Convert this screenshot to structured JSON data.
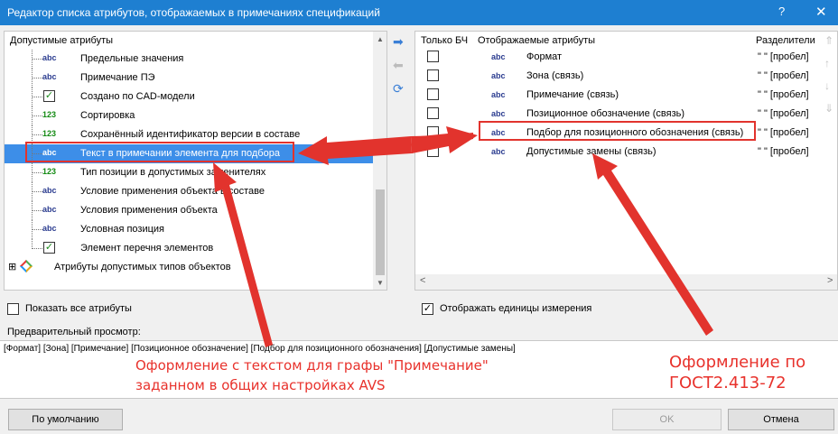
{
  "window": {
    "title": "Редактор списка атрибутов, отображаемых в примечаниях спецификаций",
    "help_glyph": "?",
    "close_glyph": "✕"
  },
  "left": {
    "header": "Допустимые атрибуты",
    "items": [
      {
        "type": "abc",
        "label": "Предельные значения"
      },
      {
        "type": "abc",
        "label": "Примечание ПЭ"
      },
      {
        "type": "check",
        "label": "Создано по CAD-модели",
        "mark": "✓"
      },
      {
        "type": "123",
        "label": "Сортировка"
      },
      {
        "type": "123",
        "label": "Сохранённый идентификатор версии в составе"
      },
      {
        "type": "abc",
        "label": "Текст в примечании элемента для подбора",
        "selected": true
      },
      {
        "type": "123",
        "label": "Тип позиции в допустимых заменителях"
      },
      {
        "type": "abc",
        "label": "Условие применения объекта в составе"
      },
      {
        "type": "abc",
        "label": "Условия применения объекта"
      },
      {
        "type": "abc",
        "label": "Условная позиция"
      },
      {
        "type": "check",
        "label": "Элемент перечня элементов",
        "mark": "✓"
      }
    ],
    "group": {
      "label": "Атрибуты допустимых типов объектов",
      "expander": "⊞"
    },
    "show_all": {
      "label": "Показать все атрибуты",
      "checked": false
    }
  },
  "right": {
    "headers": {
      "only_bch": "Только БЧ",
      "attrs": "Отображаемые атрибуты",
      "separators": "Разделители"
    },
    "rows": [
      {
        "type": "abc",
        "name": "Формат",
        "sep": "\" \" [пробел]"
      },
      {
        "type": "abc",
        "name": "Зона (связь)",
        "sep": "\" \" [пробел]"
      },
      {
        "type": "abc",
        "name": "Примечание (связь)",
        "sep": "\" \" [пробел]"
      },
      {
        "type": "abc",
        "name": "Позиционное обозначение (связь)",
        "sep": "\" \" [пробел]"
      },
      {
        "type": "abc",
        "name": "Подбор для позиционного обозначения (связь)",
        "sep": "\" \" [пробел]"
      },
      {
        "type": "abc",
        "name": "Допустимые замены (связь)",
        "sep": "\" \" [пробел]"
      }
    ],
    "show_units": {
      "label": "Отображать единицы измерения",
      "checked": true,
      "mark": "✓"
    }
  },
  "preview": {
    "label": "Предварительный просмотр:",
    "text": "[Формат] [Зона] [Примечание] [Позиционное обозначение] [Подбор для позиционного обозначения] [Допустимые замены]"
  },
  "buttons": {
    "default": "По умолчанию",
    "ok": "OK",
    "cancel": "Отмена"
  },
  "annotations": {
    "left_line1": "Оформление с текстом для графы \"Примечание\"",
    "left_line2": "заданном в общих настройках AVS",
    "right_line1": "Оформление по",
    "right_line2": "ГОСТ2.413-72"
  },
  "icons": {
    "scroll_up": "▲",
    "scroll_down": "▼",
    "arrow_right": "➡",
    "arrow_left": "⬅",
    "refresh": "⟳",
    "scroll_left": "<",
    "scroll_right": ">",
    "move_top": "⇑",
    "move_up": "↑",
    "move_down": "↓",
    "move_bottom": "⇓"
  },
  "colors": {
    "title_bar": "#1e7fd1",
    "selection": "#3d8ee8",
    "annotation": "#e8322c"
  }
}
